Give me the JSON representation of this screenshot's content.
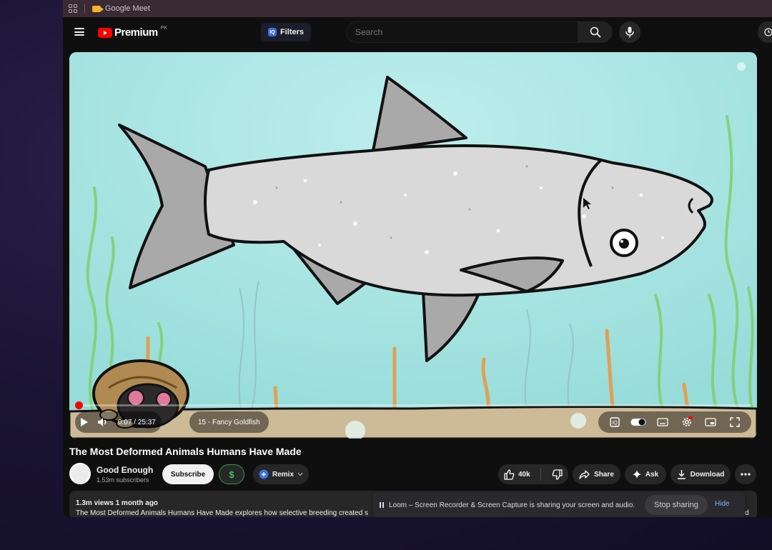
{
  "browser": {
    "tab_title": "Google Meet"
  },
  "header": {
    "logo_text": "Premium",
    "logo_region": "PK",
    "filters_label": "Filters",
    "filters_icon_text": "IQ",
    "search_placeholder": "Search"
  },
  "player": {
    "current_time": "0:07",
    "duration": "25:37",
    "time_display": "0:07 / 25:37",
    "chapter": "15 - Fancy Goldfish",
    "progress_fraction": 0.005
  },
  "video": {
    "title": "The Most Deformed Animals Humans Have Made",
    "channel": "Good Enough",
    "subscribers": "1.53m subscribers",
    "subscribe_label": "Subscribe",
    "dollar_label": "$",
    "remix_label": "Remix",
    "likes": "40k",
    "share_label": "Share",
    "ask_label": "Ask",
    "download_label": "Download",
    "views_date": "1.3m views  1 month ago",
    "description": "The Most Deformed Animals Humans Have Made explores how selective breeding created s",
    "description_tail": "and"
  },
  "loom_banner": {
    "message": "Loom – Screen Recorder & Screen Capture is sharing your screen and audio.",
    "stop_label": "Stop sharing",
    "hide_label": "Hide"
  },
  "colors": {
    "accent_red": "#ff0000",
    "water": "#a7e4e1",
    "link_blue": "#8ab4f8"
  }
}
